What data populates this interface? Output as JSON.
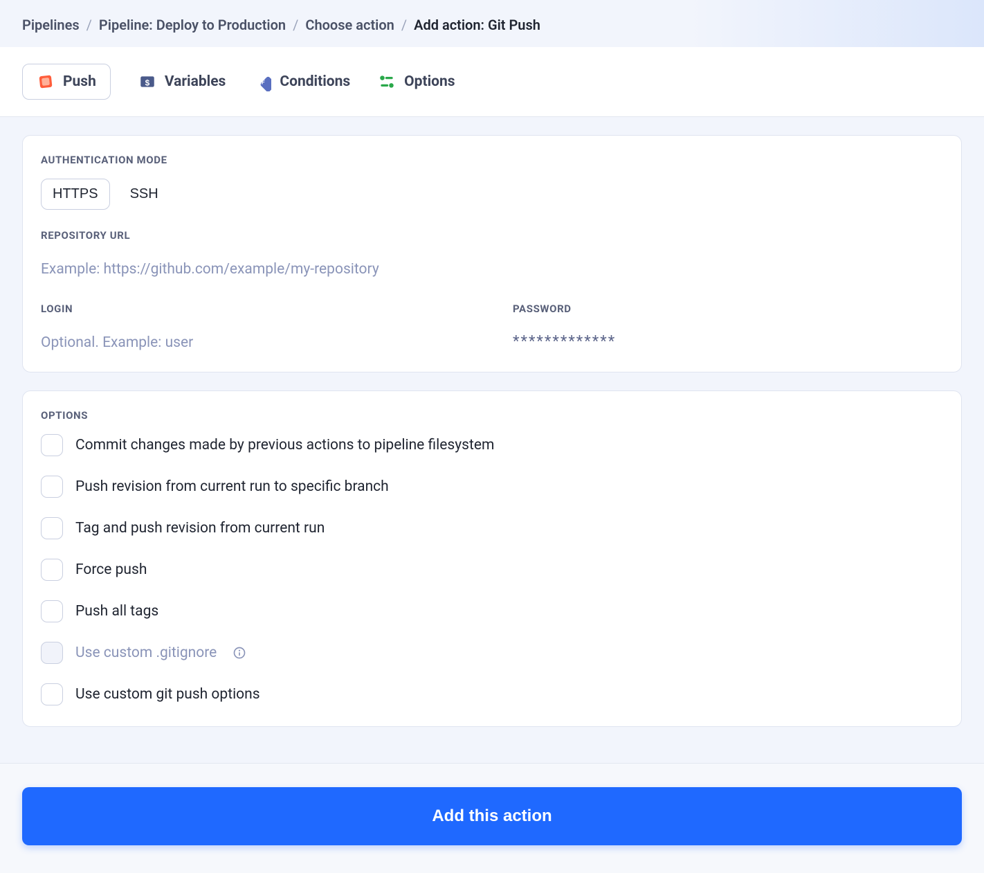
{
  "breadcrumb": {
    "items": [
      "Pipelines",
      "Pipeline: Deploy to Production",
      "Choose action"
    ],
    "current": "Add action: Git Push"
  },
  "tabs": {
    "push": "Push",
    "variables": "Variables",
    "conditions": "Conditions",
    "options": "Options"
  },
  "auth": {
    "section_label": "Authentication mode",
    "https": "HTTPS",
    "ssh": "SSH",
    "repo_label": "Repository URL",
    "repo_placeholder": "Example: https://github.com/example/my-repository",
    "login_label": "Login",
    "login_placeholder": "Optional. Example: user",
    "password_label": "Password",
    "password_mask": "*************"
  },
  "options_panel": {
    "section_label": "Options",
    "items": [
      {
        "label": "Commit changes made by previous actions to pipeline filesystem",
        "disabled": false
      },
      {
        "label": "Push revision from current run to specific branch",
        "disabled": false
      },
      {
        "label": "Tag and push revision from current run",
        "disabled": false
      },
      {
        "label": "Force push",
        "disabled": false
      },
      {
        "label": "Push all tags",
        "disabled": false
      },
      {
        "label": "Use custom .gitignore",
        "disabled": true,
        "info": true
      },
      {
        "label": "Use custom git push options",
        "disabled": false
      }
    ]
  },
  "footer": {
    "submit": "Add this action"
  }
}
